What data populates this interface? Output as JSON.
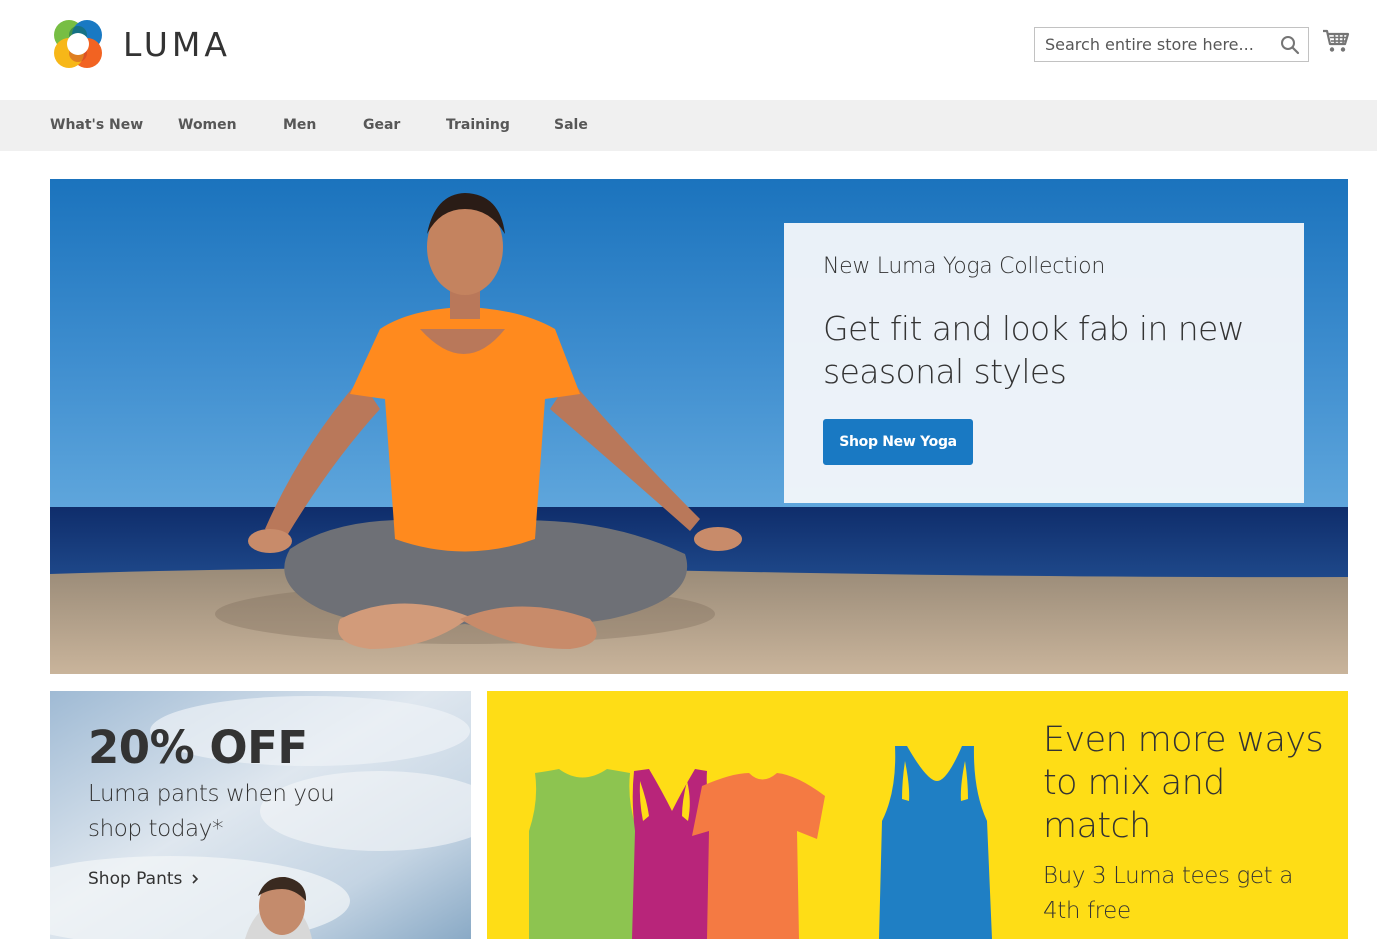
{
  "brand": {
    "name": "LUMA",
    "colors": {
      "accent": "#1979c3",
      "nav_bg": "#f0f0f0",
      "promo_yellow": "#fedd16",
      "logo": [
        "#f26322",
        "#f7b718",
        "#77be43",
        "#1979c3"
      ]
    }
  },
  "search": {
    "placeholder": "Search entire store here...",
    "icon": "search-icon"
  },
  "cart": {
    "icon": "cart-icon"
  },
  "nav": {
    "items": [
      {
        "label": "What's New"
      },
      {
        "label": "Women"
      },
      {
        "label": "Men"
      },
      {
        "label": "Gear"
      },
      {
        "label": "Training"
      },
      {
        "label": "Sale"
      }
    ]
  },
  "hero": {
    "subtitle": "New Luma Yoga Collection",
    "title": "Get fit and look fab in new seasonal styles",
    "button_label": "Shop New Yoga"
  },
  "promo_pants": {
    "title": "20% OFF",
    "text": "Luma pants when you shop today*",
    "link_label": "Shop Pants"
  },
  "promo_tees": {
    "title": "Even more ways to mix and match",
    "text": "Buy 3 Luma tees get a 4th free"
  }
}
